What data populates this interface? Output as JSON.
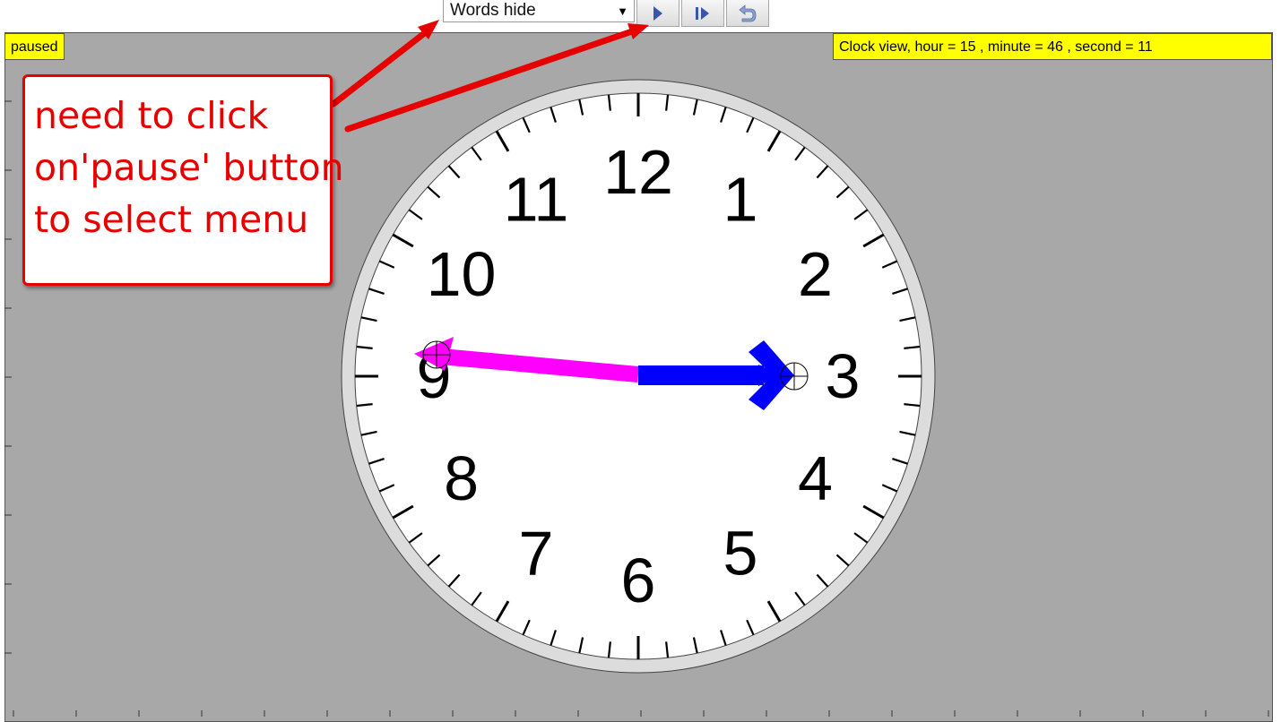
{
  "toolbar": {
    "select_value": "Words hide",
    "select_caret": "▼",
    "play_icon": "play-icon",
    "step_icon": "step-forward-icon",
    "reset_icon": "reset-icon"
  },
  "status": {
    "left": "paused",
    "right": "Clock view, hour = 15 , minute = 46 , second = 11"
  },
  "callout": {
    "line1": "need to click",
    "line2": "on'pause' button",
    "line3": "to select menu"
  },
  "clock": {
    "numbers": [
      "12",
      "1",
      "2",
      "3",
      "4",
      "5",
      "6",
      "7",
      "8",
      "9",
      "10",
      "11"
    ],
    "minute_hand_color": "#ff00ff",
    "hour_hand_color": "#0000ff",
    "accent_color": "#e60000"
  }
}
